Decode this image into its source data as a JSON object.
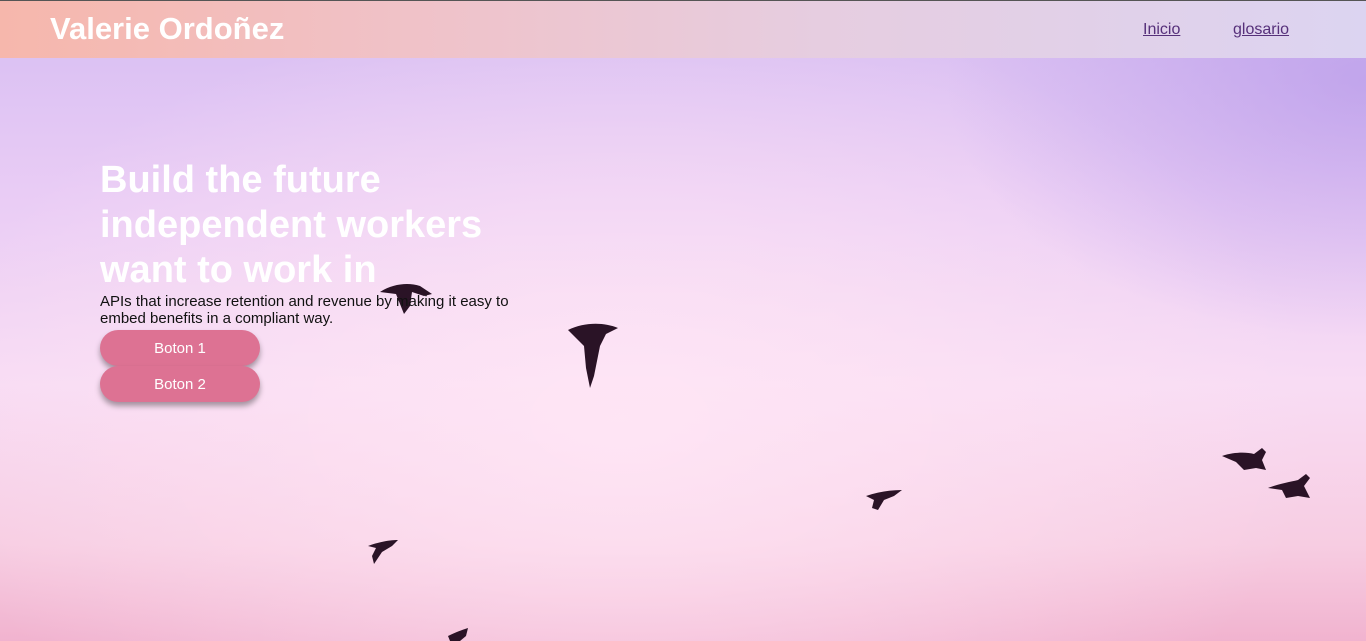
{
  "header": {
    "brand": "Valerie Ordoñez",
    "nav": {
      "inicio": "Inicio",
      "glosario": "glosario"
    }
  },
  "hero": {
    "title": "Build the future independent workers want to work in",
    "subtitle": "APIs that increase retention and revenue by making it easy to embed benefits in a compliant way.",
    "buttons": {
      "primary": "Boton 1",
      "secondary": "Boton 2"
    }
  },
  "colors": {
    "button": "#dd7293",
    "nav_link": "#56307a",
    "brand_text": "#ffffff"
  }
}
